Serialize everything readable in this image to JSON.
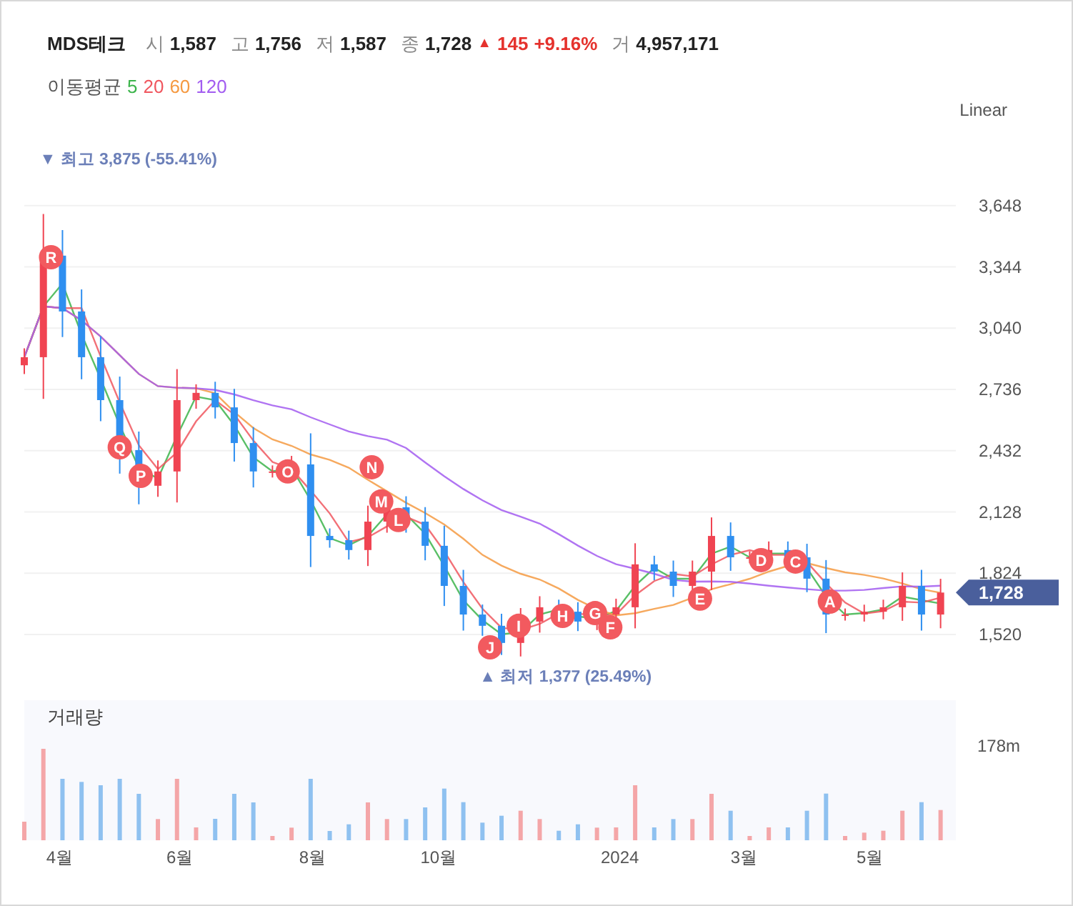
{
  "header": {
    "title": "MDS테크",
    "quotes": [
      {
        "label": "시",
        "value": "1,587"
      },
      {
        "label": "고",
        "value": "1,756"
      },
      {
        "label": "저",
        "value": "1,587"
      },
      {
        "label": "종",
        "value": "1,728"
      }
    ],
    "change": {
      "arrow": "▲",
      "amount": "145",
      "percent": "+9.16%"
    },
    "volume": {
      "label": "거",
      "value": "4,957,171"
    }
  },
  "moving_average": {
    "label": "이동평균",
    "lines": [
      {
        "period": "5",
        "color": "#3cb44b"
      },
      {
        "period": "20",
        "color": "#f0575f"
      },
      {
        "period": "60",
        "color": "#f59a42"
      },
      {
        "period": "120",
        "color": "#a25cf0"
      }
    ]
  },
  "scale": "Linear",
  "price_chart": {
    "price_axis": [
      "3,648",
      "3,344",
      "3,040",
      "2,736",
      "2,432",
      "2,128",
      "1,824",
      "1,520"
    ],
    "high_label": "▼ 최고 3,875 (-55.41%)",
    "low_label": "▲ 최저 1,377 (25.49%)",
    "signals": [
      {
        "label": "R"
      },
      {
        "label": "Q"
      },
      {
        "label": "P"
      },
      {
        "label": "O"
      },
      {
        "label": "N"
      },
      {
        "label": "M"
      },
      {
        "label": "L"
      },
      {
        "label": "J"
      },
      {
        "label": "I"
      },
      {
        "label": "H"
      },
      {
        "label": "G"
      },
      {
        "label": "F"
      },
      {
        "label": "E"
      },
      {
        "label": "D"
      },
      {
        "label": "C"
      },
      {
        "label": "A"
      }
    ],
    "current_price": "1,728",
    "time_axis": [
      "4월",
      "6월",
      "8월",
      "10월",
      "2024",
      "3월",
      "5월"
    ]
  },
  "volume_panel": {
    "title": "거래량",
    "max_label": "178m"
  }
}
